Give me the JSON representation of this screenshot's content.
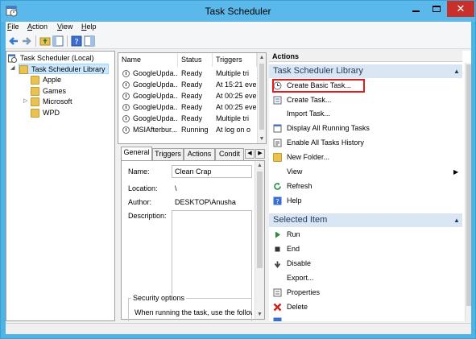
{
  "window": {
    "title": "Task Scheduler"
  },
  "menu": [
    {
      "accel": "F",
      "rest": "ile"
    },
    {
      "accel": "A",
      "rest": "ction"
    },
    {
      "accel": "V",
      "rest": "iew"
    },
    {
      "accel": "H",
      "rest": "elp"
    }
  ],
  "toolbar": [
    "back-icon",
    "forward-icon",
    "up-folder-icon",
    "show-pane-icon",
    "help-icon",
    "properties-pane-icon"
  ],
  "tree": {
    "root": "Task Scheduler (Local)",
    "library": "Task Scheduler Library",
    "folders": [
      "Apple",
      "Games",
      "Microsoft",
      "WPD"
    ]
  },
  "task_list": {
    "columns": [
      "Name",
      "Status",
      "Triggers"
    ],
    "rows": [
      [
        "GoogleUpda...",
        "Ready",
        "Multiple tri"
      ],
      [
        "GoogleUpda...",
        "Ready",
        "At 15:21 eve"
      ],
      [
        "GoogleUpda...",
        "Ready",
        "At 00:25 eve"
      ],
      [
        "GoogleUpda...",
        "Ready",
        "At 00:25 eve"
      ],
      [
        "GoogleUpda...",
        "Ready",
        "Multiple tri"
      ],
      [
        "MSIAfterbur...",
        "Running",
        "At log on o"
      ]
    ]
  },
  "details": {
    "tabs": [
      "General",
      "Triggers",
      "Actions",
      "Condit"
    ],
    "name_label": "Name:",
    "name_value": "Clean Crap",
    "location_label": "Location:",
    "location_value": "\\",
    "author_label": "Author:",
    "author_value": "DESKTOP\\Anusha",
    "description_label": "Description:",
    "security_label": "Security options",
    "security_text": "When running the task, use the follow"
  },
  "actions_pane": {
    "title": "Actions",
    "section1": "Task Scheduler Library",
    "section1_items": [
      "Create Basic Task...",
      "Create Task...",
      "Import Task...",
      "Display All Running Tasks",
      "Enable All Tasks History",
      "New Folder...",
      "View",
      "Refresh",
      "Help"
    ],
    "section2": "Selected Item",
    "section2_items": [
      "Run",
      "End",
      "Disable",
      "Export...",
      "Properties",
      "Delete"
    ]
  },
  "colors": {
    "titlebar": "#5ab8ea",
    "close": "#c7302b",
    "highlight": "#e21c1c",
    "section_header": "#dbe6f4"
  }
}
